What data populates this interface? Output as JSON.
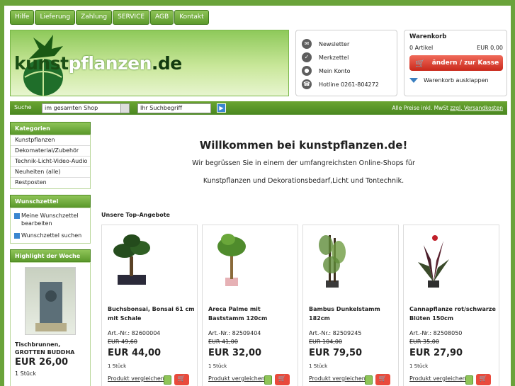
{
  "topnav": [
    "Hilfe",
    "Lieferung",
    "Zahlung",
    "SERVICE",
    "AGB",
    "Kontakt"
  ],
  "logo": {
    "part1": "kunst",
    "part2": "pflanzen",
    "part3": ".de"
  },
  "service": {
    "newsletter": "Newsletter",
    "merkzettel": "Merkzettel",
    "konto": "Mein Konto",
    "hotline": "Hotline 0261-804272"
  },
  "cart": {
    "title": "Warenkorb",
    "items": "0 Artikel",
    "total": "EUR 0,00",
    "button": "ändern / zur Kasse",
    "expand": "Warenkorb ausklappen"
  },
  "search": {
    "label": "Suche",
    "scope": "im gesamten Shop",
    "placeholder": "Ihr Suchbegriff",
    "prices_note": "Alle Preise inkl. MwSt",
    "shipping_link": "zzgl. Versandkosten"
  },
  "sidebar": {
    "categories_title": "Kategorien",
    "categories": [
      "Kunstpflanzen",
      "Dekomaterial/Zubehör",
      "Technik-Licht-Video-Audio",
      "Neuheiten (alle)",
      "Restposten"
    ],
    "wishlist_title": "Wunschzettel",
    "wishlist_items": [
      "Meine Wunschzettel bearbeiten",
      "Wunschzettel suchen"
    ],
    "highlight_title": "Highlight der Woche",
    "highlight_name": "Tischbrunnen, GROTTEN BUDDHA",
    "highlight_price": "EUR 26,00",
    "highlight_qty": "1 Stück"
  },
  "main": {
    "title": "Willkommen bei kunstpflanzen.de!",
    "text1": "Wir begrüssen Sie in einem der umfangreichsten Online-Shops für",
    "text2": "Kunstpflanzen und Dekorationsbedarf,Licht und Tontechnik.",
    "top_title": "Unsere Top-Angebote"
  },
  "products": [
    {
      "name": "Buchsbonsai, Bonsai 61 cm mit Schale",
      "art": "Art.-Nr.: 82600004",
      "old": "EUR 49,60",
      "price": "EUR 44,00",
      "qty": "1 Stück",
      "compare": "Produkt vergleichen"
    },
    {
      "name": "Areca Palme mit Baststamm 120cm",
      "art": "Art.-Nr.: 82509404",
      "old": "EUR 41,00",
      "price": "EUR 32,00",
      "qty": "1 Stück",
      "compare": "Produkt vergleichen"
    },
    {
      "name": "Bambus Dunkelstamm 182cm",
      "art": "Art.-Nr.: 82509245",
      "old": "EUR 104,00",
      "price": "EUR 79,50",
      "qty": "1 Stück",
      "compare": "Produkt vergleichen"
    },
    {
      "name": "Cannapflanze rot/schwarze Blüten 150cm",
      "art": "Art.-Nr.: 82508050",
      "old": "EUR 35,00",
      "price": "EUR 27,90",
      "qty": "1 Stück",
      "compare": "Produkt vergleichen"
    }
  ]
}
